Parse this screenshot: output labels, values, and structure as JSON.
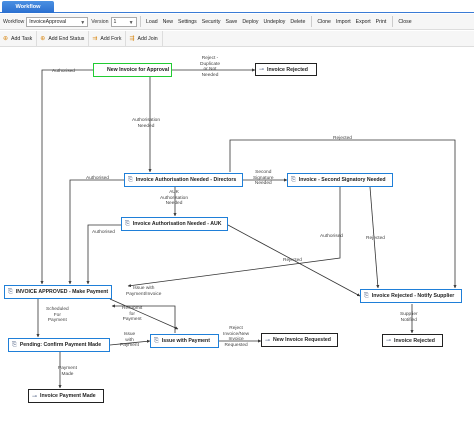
{
  "tabs": {
    "workflow": "Workflow"
  },
  "toolbar": {
    "workflow_label": "Workflow",
    "workflow_value": "InvoiceApproval",
    "version_label": "Version",
    "version_value": "1",
    "buttons": [
      "Load",
      "New",
      "Settings",
      "Security",
      "Save",
      "Deploy",
      "Undeploy",
      "Delete",
      "Clone",
      "Import",
      "Export",
      "Print",
      "Close"
    ]
  },
  "actions": {
    "add_task": "Add Task",
    "add_end_status": "Add End Status",
    "add_fork": "Add Fork",
    "add_join": "Add Join"
  },
  "nodes": {
    "new_invoice": "New Invoice for Approval",
    "invoice_rejected_top": "Invoice Rejected",
    "auth_directors": "Invoice Authorisation Needed - Directors",
    "second_signatory": "Invoice - Second Signatory Needed",
    "auth_auk": "Invoice Authorisation Needed - AUK",
    "invoice_approved": "INVOICE APPROVED - Make Payment",
    "rejected_notify": "Invoice Rejected - Notify Supplier",
    "pending_confirm": "Pending: Confirm Payment Made",
    "issue_payment": "Issue with Payment",
    "new_invoice_requested": "New Invoice Requested",
    "invoice_rejected_bottom": "Invoice Rejected",
    "payment_made": "Invoice Payment Made"
  },
  "edges": {
    "reject_duplicate": [
      "Reject -",
      "Duplicate",
      "or Not",
      "Needed"
    ],
    "authorised_1": "Authorised",
    "authorisation_needed": [
      "Authorisation",
      "Needed"
    ],
    "authorised_2": "Authorised",
    "second_sig_needed": [
      "Second",
      "Signature",
      "Needed"
    ],
    "rejected_1": "Rejected",
    "auk_auth_needed": [
      "AUK",
      "Authorisation",
      "Needed"
    ],
    "authorised_3": "Authorised",
    "authorised_4": "Authorised",
    "rejected_2": "Rejected",
    "rejected_3": "Rejected",
    "issue_with_payment": [
      "Issue with",
      "Payment/Invoice"
    ],
    "resubmit": [
      "Resubmit",
      "for",
      "Payment"
    ],
    "scheduled": [
      "Scheduled",
      "For",
      "Payment"
    ],
    "issue_with_payment_2": [
      "Issue",
      "with",
      "Payment"
    ],
    "reject_invoice_new": [
      "Reject",
      "Invoice/New",
      "Invoice",
      "Requested"
    ],
    "supplier_notified": [
      "Supplier",
      "Notified"
    ],
    "payment_made": [
      "Payment",
      "Made"
    ]
  }
}
